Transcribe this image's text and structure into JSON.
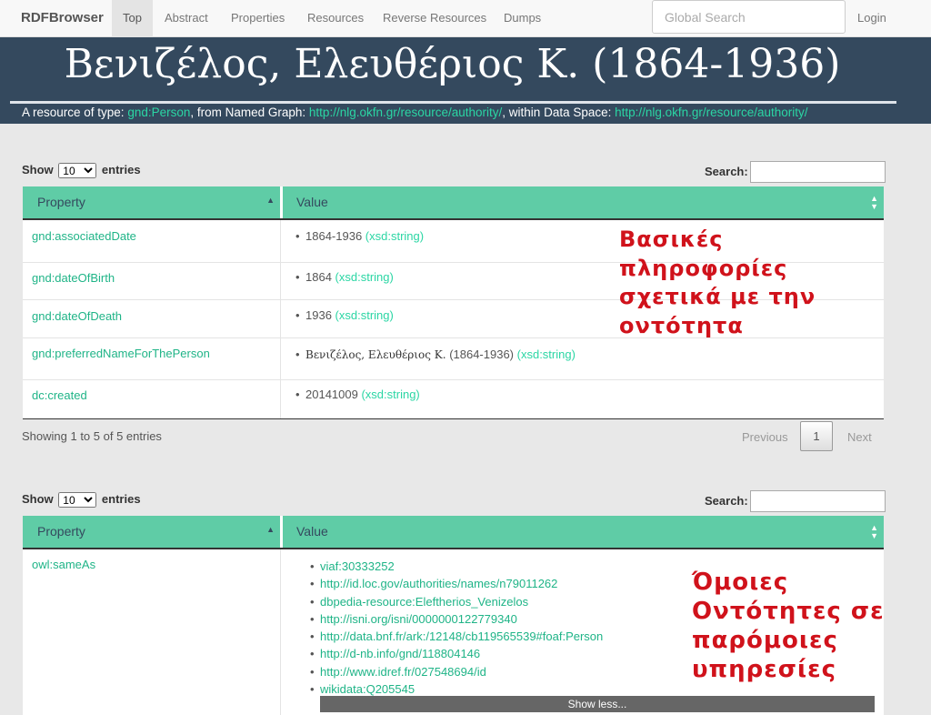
{
  "nav": {
    "brand": "RDFBrowser",
    "items": [
      "Top",
      "Abstract",
      "Properties",
      "Resources",
      "Reverse Resources",
      "Dumps"
    ],
    "search_placeholder": "Global Search",
    "login": "Login"
  },
  "header": {
    "title": "Βενιζέλος, Ελευθέριος Κ. (1864-1936)",
    "sub_prefix": "A resource of type: ",
    "type": "gnd:Person",
    "sub_mid": ", from Named Graph: ",
    "graph": "http://nlg.okfn.gr/resource/authority/",
    "sub_mid2": ", within Data Space: ",
    "space": "http://nlg.okfn.gr/resource/authority/"
  },
  "table1": {
    "show": "Show",
    "entries": "entries",
    "length": "10",
    "search_label": "Search:",
    "col_property": "Property",
    "col_value": "Value",
    "rows": [
      {
        "property": "gnd:associatedDate",
        "value": "1864-1936",
        "type": "(xsd:string)"
      },
      {
        "property": "gnd:dateOfBirth",
        "value": "1864",
        "type": "(xsd:string)"
      },
      {
        "property": "gnd:dateOfDeath",
        "value": "1936",
        "type": "(xsd:string)"
      },
      {
        "property": "gnd:preferredNameForThePerson",
        "value": "Βενιζέλος, Ελευθέριος Κ.",
        "value2": "(1864-1936)",
        "type": "(xsd:string)"
      },
      {
        "property": "dc:created",
        "value": "20141009",
        "type": "(xsd:string)"
      }
    ],
    "info": "Showing 1 to 5 of 5 entries",
    "prev": "Previous",
    "page": "1",
    "next": "Next",
    "annotation": [
      "Βασικές",
      "πληροφορίες",
      "σχετικά με την",
      "οντότητα"
    ]
  },
  "table2": {
    "show": "Show",
    "entries": "entries",
    "length": "10",
    "search_label": "Search:",
    "col_property": "Property",
    "col_value": "Value",
    "property": "owl:sameAs",
    "links": [
      "viaf:30333252",
      "http://id.loc.gov/authorities/names/n79011262",
      "dbpedia-resource:Eleftherios_Venizelos",
      "http://isni.org/isni/0000000122779340",
      "http://data.bnf.fr/ark:/12148/cb119565539#foaf:Person",
      "http://d-nb.info/gnd/118804146",
      "http://www.idref.fr/027548694/id",
      "wikidata:Q205545"
    ],
    "show_less": "Show less...",
    "annotation": [
      "Όμοιες",
      "Οντότητες σε",
      "παρόμοιες",
      "υπηρεσίες"
    ]
  },
  "colors": {
    "header_bg": "#34495e",
    "accent": "#5fcca6",
    "link": "#1fb487",
    "annotation": "#d0121b"
  }
}
